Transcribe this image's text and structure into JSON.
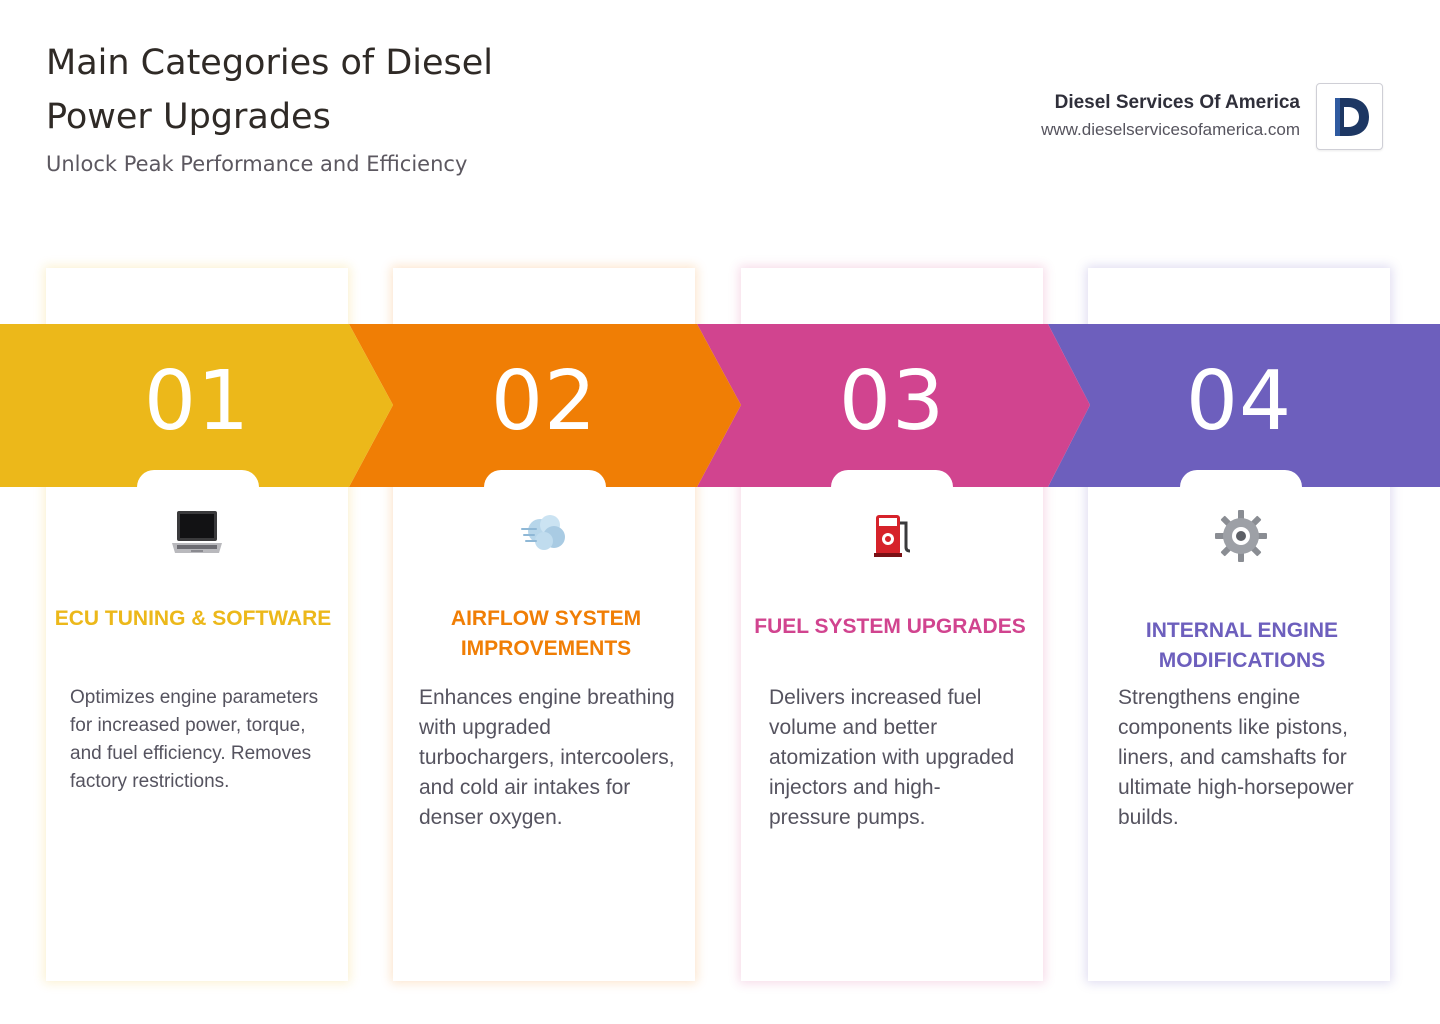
{
  "header": {
    "title": "Main Categories of Diesel Power Upgrades",
    "subtitle": "Unlock Peak Performance and Efficiency"
  },
  "brand": {
    "name": "Diesel Services Of America",
    "url": "www.dieselservicesofamerica.com",
    "logo_letter": "D",
    "logo_color": "#1d3763"
  },
  "colors": {
    "step1": "#ecb81a",
    "step2": "#f07e05",
    "step3": "#d1448f",
    "step4": "#6d5fbd"
  },
  "steps": [
    {
      "number": "01",
      "icon": "laptop-icon",
      "title": "ECU TUNING & SOFTWARE",
      "text": "Optimizes engine parameters for increased power, torque, and fuel efficiency. Removes factory restrictions."
    },
    {
      "number": "02",
      "icon": "wind-icon",
      "title": "AIRFLOW SYSTEM IMPROVEMENTS",
      "text": "Enhances engine breathing with upgraded turbochargers, intercoolers, and cold air intakes for denser oxygen."
    },
    {
      "number": "03",
      "icon": "fuel-pump-icon",
      "title": "FUEL SYSTEM UPGRADES",
      "text": "Delivers increased fuel volume and better atomization with upgraded injectors and high-pressure pumps."
    },
    {
      "number": "04",
      "icon": "gear-icon",
      "title": "INTERNAL ENGINE MODIFICATIONS",
      "text": "Strengthens engine components like pistons, liners, and camshafts for ultimate high-horsepower builds."
    }
  ]
}
